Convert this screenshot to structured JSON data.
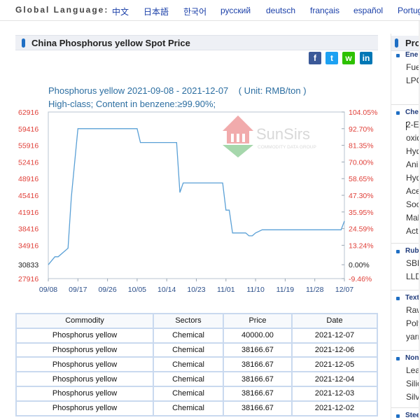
{
  "language_bar": {
    "label": "Global Language:",
    "languages": [
      "中文",
      "日本語",
      "한국어",
      "русский",
      "deutsch",
      "français",
      "español",
      "Portug"
    ]
  },
  "page_title": "China Phosphorus yellow Spot Price",
  "share": {
    "icons": [
      {
        "name": "facebook-icon",
        "color": "#3b5998",
        "glyph": "f"
      },
      {
        "name": "twitter-icon",
        "color": "#1da1f2",
        "glyph": "t"
      },
      {
        "name": "wechat-icon",
        "color": "#2dc100",
        "glyph": "w"
      },
      {
        "name": "linkedin-icon",
        "color": "#0077b5",
        "glyph": "in"
      }
    ]
  },
  "chart_data": {
    "type": "line",
    "title": "Phosphorus yellow 2021-09-08 - 2021-12-07",
    "unit": "( Unit: RMB/ton )",
    "subtitle": "High-class; Content in benzene:≥99.90%;",
    "watermark": {
      "brand": "SunSirs",
      "tagline": "COMMODITY DATA GROUP"
    },
    "line_color": "#5aa0d6",
    "left_axis_color": "#e0413a",
    "y_ticks": [
      "62916",
      "59416",
      "55916",
      "52416",
      "48916",
      "45416",
      "41916",
      "38416",
      "34916",
      "30833",
      "27916"
    ],
    "right_ticks": [
      "104.05%",
      "92.70%",
      "81.35%",
      "70.00%",
      "58.65%",
      "47.30%",
      "35.95%",
      "24.59%",
      "13.24%",
      "0.00%",
      "-9.46%"
    ],
    "x_ticks": [
      "09/08",
      "09/17",
      "09/26",
      "10/05",
      "10/14",
      "10/23",
      "11/01",
      "11/10",
      "11/19",
      "11/28",
      "12/07"
    ],
    "ylim": [
      27916,
      62916
    ],
    "x": [
      "2021-09-08",
      "2021-09-10",
      "2021-09-11",
      "2021-09-14",
      "2021-09-15",
      "2021-09-17",
      "2021-10-05",
      "2021-10-06",
      "2021-10-17",
      "2021-10-18",
      "2021-10-19",
      "2021-10-31",
      "2021-11-01",
      "2021-11-02",
      "2021-11-03",
      "2021-11-07",
      "2021-11-08",
      "2021-11-09",
      "2021-11-10",
      "2021-11-12",
      "2021-11-19",
      "2021-12-06",
      "2021-12-07"
    ],
    "values": [
      30833,
      32500,
      32500,
      34300,
      45000,
      59416,
      59416,
      56500,
      56500,
      46000,
      48000,
      48000,
      42300,
      42300,
      37500,
      37500,
      36900,
      36900,
      37500,
      38166.67,
      38166.67,
      38166.67,
      40000
    ]
  },
  "table": {
    "headers": [
      "Commodity",
      "Sectors",
      "Price",
      "Date"
    ],
    "rows": [
      [
        "Phosphorus yellow",
        "Chemical",
        "40000.00",
        "2021-12-07"
      ],
      [
        "Phosphorus yellow",
        "Chemical",
        "38166.67",
        "2021-12-06"
      ],
      [
        "Phosphorus yellow",
        "Chemical",
        "38166.67",
        "2021-12-05"
      ],
      [
        "Phosphorus yellow",
        "Chemical",
        "38166.67",
        "2021-12-04"
      ],
      [
        "Phosphorus yellow",
        "Chemical",
        "38166.67",
        "2021-12-03"
      ],
      [
        "Phosphorus yellow",
        "Chemical",
        "38166.67",
        "2021-12-02"
      ]
    ]
  },
  "sidebar": {
    "title": "Pro",
    "sections": [
      {
        "label": "Ener",
        "items": [
          "Fue",
          "LPG"
        ]
      },
      {
        "label": "Cher",
        "items": [
          "2-E",
          "oxid",
          "Hyd",
          "Anil",
          "Hyd",
          "Ace",
          "Soc",
          "Mal",
          "Acti"
        ]
      },
      {
        "label": "Rubl",
        "items": [
          "SBF",
          "LLD"
        ]
      },
      {
        "label": "Text",
        "items": [
          "Raw",
          "Poly",
          "yarn"
        ]
      },
      {
        "label": "Non-",
        "items": [
          "Lea",
          "Silic",
          "Silv"
        ]
      },
      {
        "label": "Steel",
        "items": []
      }
    ]
  }
}
